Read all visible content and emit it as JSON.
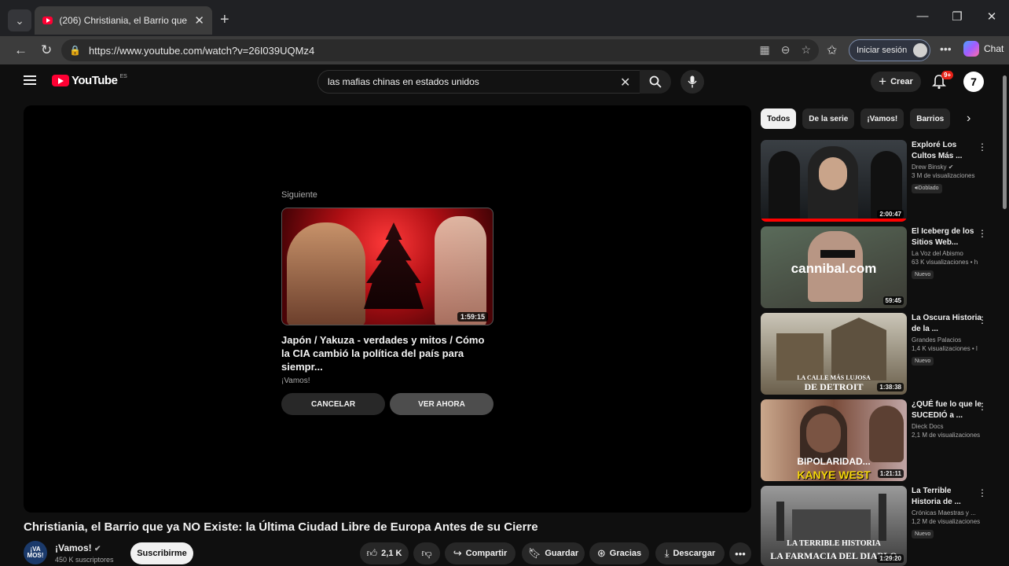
{
  "browser": {
    "tab_title": "(206) Christiania, el Barrio que ya N",
    "url": "https://www.youtube.com/watch?v=26I039UQMz4",
    "signin_label": "Iniciar sesión",
    "copilot_label": "Chat"
  },
  "youtube": {
    "logo_text": "YouTube",
    "logo_country": "ES",
    "search_query": "las mafias chinas en estados unidos",
    "create_label": "Crear",
    "notif_badge": "9+"
  },
  "upnext": {
    "label": "Siguiente",
    "duration": "1:59:15",
    "title": "Japón / Yakuza - verdades y mitos / Cómo la CIA cambió la política del país para siempr...",
    "channel": "¡Vamos!",
    "cancel_label": "CANCELAR",
    "watch_label": "VER AHORA"
  },
  "video": {
    "title": "Christiania, el Barrio que ya NO Existe: la Última Ciudad Libre de Europa Antes de su Cierre",
    "channel_name": "¡Vamos!",
    "channel_avatar": "¡VA MOS!",
    "subscribers": "450 K suscriptores",
    "subscribe_label": "Suscribirme",
    "likes": "2,1 K",
    "share_label": "Compartir",
    "save_label": "Guardar",
    "thanks_label": "Gracias",
    "download_label": "Descargar"
  },
  "chips": [
    "Todos",
    "De la serie",
    "¡Vamos!",
    "Barrios"
  ],
  "recommendations": [
    {
      "title": "Exploré Los Cultos Más ...",
      "channel": "Drew Binsky",
      "meta": "3 M de visualizaciones",
      "badge": "Doblado",
      "duration": "2:00:47"
    },
    {
      "title": "El Iceberg de los Sitios Web...",
      "channel": "La Voz del Abismo",
      "meta": "63 K visualizaciones • h",
      "badge": "Nuevo",
      "duration": "59:45",
      "thumb_text": "cannibal.com"
    },
    {
      "title": "La Oscura Historia de la ...",
      "channel": "Grandes Palacios",
      "meta": "1,4 K visualizaciones • l",
      "badge": "Nuevo",
      "duration": "1:38:38",
      "thumb_text_small": "LA CALLE MÁS LUJOSA",
      "thumb_text_big": "DE DETROIT"
    },
    {
      "title": "¿QUÉ fue lo que le SUCEDIÓ a ...",
      "channel": "Dieck Docs",
      "meta": "2,1 M de visualizaciones",
      "badge": "",
      "duration": "1:21:11",
      "thumb_text_small": "BIPOLARIDAD...",
      "thumb_text_big": "KANYE WEST"
    },
    {
      "title": "La Terrible Historia de ...",
      "channel": "Crónicas Maestras y ...",
      "meta": "1,2 M de visualizaciones",
      "badge": "Nuevo",
      "duration": "1:29:20",
      "thumb_text_small": "LA TERRIBLE HISTORIA",
      "thumb_text_big": "LA FARMACIA DEL DIABLO"
    }
  ]
}
